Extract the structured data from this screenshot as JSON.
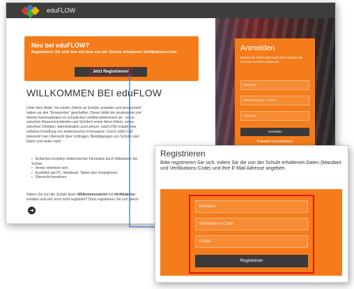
{
  "app": {
    "brand": "eduFLOW"
  },
  "neu_box": {
    "title": "Neu bei eduFLOW?",
    "text": "Registrieren Sie sich hier mit dem von der Schule erhaltenen Verifikations-Code",
    "button_label": "Jetzt Registrieren!"
  },
  "welcome": {
    "heading": "WILLKOMMEN BEI eduFLOW",
    "intro": "Unter dem Motto \"sie wieder Zetteln an Schüler austeilen und einsammeln\" haben wir den \"Einsammler\" geschaffen. Dieser bildet die strukturierte und direkte Kommunikation im schulischen Umfeld elektronisch ab - sei es zwischen Klassenvorständen und Schülern sowie deren Eltern, sei es zwischen Direktion, Administration und Lehrern. eduFLOW erlaubt eine einfache Erstellung von elektronischen Formularen. Durch eduFLOW bekommt man Übersicht über Umfragen, Bestätigungen von Schüler und Eltern und vieles mehr",
    "bullets": [
      "Einfaches Erstellen elektronischer Formulare durch Mitarbeiter der Schule",
      "Immer informiert sein",
      "Ausfüllen auf PC, Notebook, Tablet oder Smartphone",
      "Übersicht bewahren"
    ],
    "outro_start": "Haben Sie von der Schule einen ",
    "outro_bold": "Willkommensbrief",
    "outro_mid": " mit ",
    "outro_bold2": "Verifikations-",
    "outro_end": "erhalten und sich noch nicht registriert? Dann registrieren Sie sich gleich"
  },
  "anmelden": {
    "title": "Anmelden",
    "text": "Bereits bei eduFLOW registriert? Melden Sie sich hier mit Ihren Daten an.",
    "fields": [
      "Mandant",
      "Benutzername / E-Mail",
      "Passwort"
    ],
    "button_label": "Anmelden",
    "link": "Passwort zurücksetzen"
  },
  "registrieren": {
    "title": "Registrieren",
    "description": "Bitte registrieren Sie sich, indem Sie die von der Schule erhaltenen Daten (Mandant und Verifikations-Code) und Ihre E-Mail Adresse angeben.",
    "fields": [
      "Mandant",
      "Verifikations-Code",
      "E-Mail"
    ],
    "button_label": "Registrieren"
  },
  "colors": {
    "accent": "#f47c1b",
    "topbar": "#3d3d3d",
    "highlight": "#e01515",
    "connector": "#3a78c9"
  },
  "icons": [
    "edulogo-icon",
    "arrow-circle-icon",
    "connector-arrow-icon"
  ]
}
